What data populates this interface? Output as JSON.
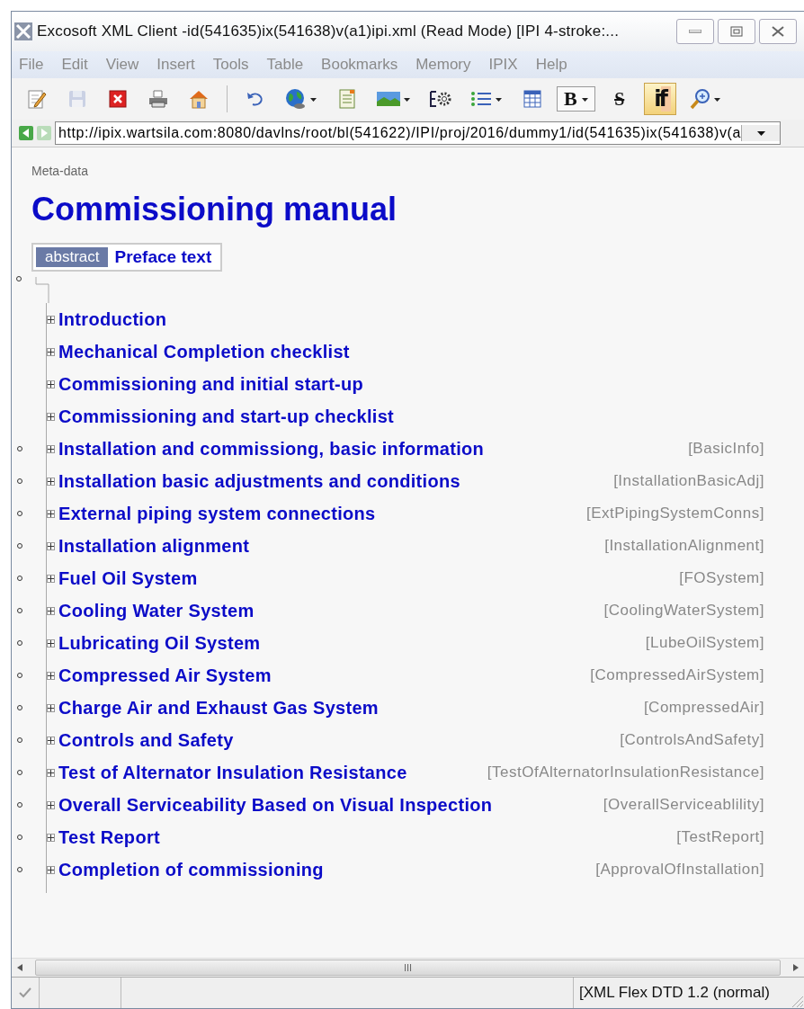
{
  "window": {
    "title": "Excosoft XML Client -id(541635)ix(541638)v(a1)ipi.xml (Read Mode) [IPI 4-stroke:..."
  },
  "menu": [
    "File",
    "Edit",
    "View",
    "Insert",
    "Tools",
    "Table",
    "Bookmarks",
    "Memory",
    "IPIX",
    "Help"
  ],
  "toolbar": [
    {
      "kind": "edit",
      "dropdown": false,
      "disabled": false,
      "pressed": false
    },
    {
      "kind": "save",
      "dropdown": false,
      "disabled": true,
      "pressed": false
    },
    {
      "kind": "close",
      "dropdown": false,
      "disabled": false,
      "pressed": false
    },
    {
      "kind": "print",
      "dropdown": false,
      "disabled": false,
      "pressed": false
    },
    {
      "kind": "home",
      "dropdown": false,
      "disabled": false,
      "pressed": false
    },
    {
      "kind": "separator"
    },
    {
      "kind": "undo",
      "dropdown": false,
      "disabled": false,
      "pressed": false
    },
    {
      "kind": "globe",
      "dropdown": true,
      "disabled": false,
      "pressed": false
    },
    {
      "kind": "note",
      "dropdown": false,
      "disabled": false,
      "pressed": false
    },
    {
      "kind": "image",
      "dropdown": true,
      "disabled": false,
      "pressed": false
    },
    {
      "kind": "gear",
      "dropdown": false,
      "disabled": false,
      "pressed": false
    },
    {
      "kind": "list",
      "dropdown": true,
      "disabled": false,
      "pressed": false
    },
    {
      "kind": "table",
      "dropdown": false,
      "disabled": false,
      "pressed": false
    },
    {
      "kind": "text",
      "label": "B",
      "dropdown": true,
      "disabled": false,
      "pressed": false
    },
    {
      "kind": "strike",
      "label": "S",
      "dropdown": false,
      "disabled": false,
      "pressed": false
    },
    {
      "kind": "text",
      "label": "if",
      "dropdown": false,
      "disabled": false,
      "pressed": true
    },
    {
      "kind": "zoom",
      "dropdown": true,
      "disabled": false,
      "pressed": false
    }
  ],
  "address": {
    "back_enabled": true,
    "forward_enabled": false,
    "value": "http://ipix.wartsila.com:8080/davlns/root/bl(541622)/IPI/proj/2016/dummy1/id(541635)ix(541638)v(a"
  },
  "document": {
    "meta": "Meta-data",
    "title": "Commissioning manual",
    "abstract": {
      "label": "abstract",
      "text": "Preface text"
    },
    "sections": [
      {
        "title": "Introduction",
        "marked": false
      },
      {
        "title": "Mechanical Completion checklist",
        "marked": false
      },
      {
        "title": "Commissioning and initial start-up",
        "marked": false
      },
      {
        "title": "Commissioning and start-up checklist",
        "marked": false
      },
      {
        "title": "Installation and commissiong, basic information",
        "marked": true,
        "tag": "[BasicInfo]"
      },
      {
        "title": "Installation basic adjustments and conditions",
        "marked": true,
        "tag": "[InstallationBasicAdj]"
      },
      {
        "title": "External piping system connections",
        "marked": true,
        "tag": "[ExtPipingSystemConns]"
      },
      {
        "title": "Installation alignment",
        "marked": true,
        "tag": "[InstallationAlignment]"
      },
      {
        "title": "Fuel Oil System",
        "marked": true,
        "tag": "[FOSystem]"
      },
      {
        "title": "Cooling Water System",
        "marked": true,
        "tag": "[CoolingWaterSystem]"
      },
      {
        "title": "Lubricating Oil System",
        "marked": true,
        "tag": "[LubeOilSystem]"
      },
      {
        "title": "Compressed Air System",
        "marked": true,
        "tag": "[CompressedAirSystem]"
      },
      {
        "title": "Charge Air and Exhaust Gas System",
        "marked": true,
        "tag": "[CompressedAir]"
      },
      {
        "title": "Controls and Safety",
        "marked": true,
        "tag": "[ControlsAndSafety]"
      },
      {
        "title": "Test of Alternator Insulation Resistance",
        "marked": true,
        "tag": "[TestOfAlternatorInsulationResistance]"
      },
      {
        "title": "Overall Serviceability Based on Visual Inspection",
        "marked": true,
        "tag": "[OverallServiceablility]"
      },
      {
        "title": "Test Report",
        "marked": true,
        "tag": "[TestReport]"
      },
      {
        "title": "Completion of commissioning",
        "marked": true,
        "tag": "[ApprovalOfInstallation]"
      }
    ]
  },
  "scrollbar_glyph": "III",
  "status_bar": {
    "ok": true,
    "dtd": "[XML Flex DTD 1.2 (normal)"
  }
}
